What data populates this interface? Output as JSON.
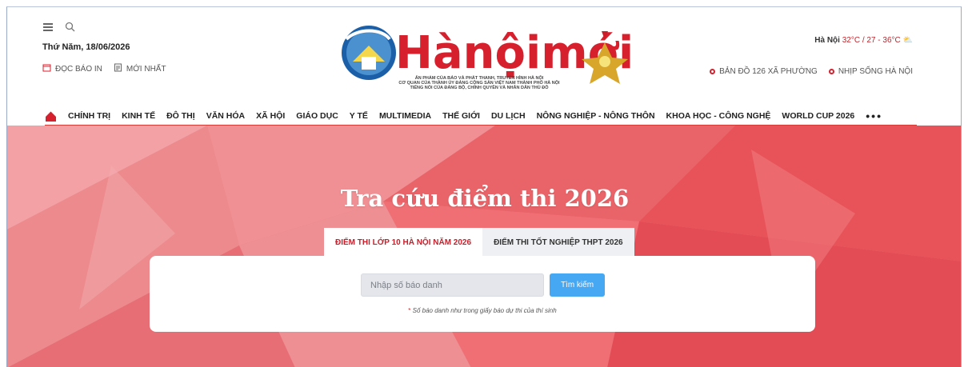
{
  "header": {
    "date": "Thứ Năm, 18/06/2026",
    "left_links": [
      "ĐỌC BÁO IN",
      "MỚI NHẤT"
    ],
    "logo_text": "Hànộimới",
    "tagline": [
      "ẤN PHẨM CỦA BÁO VÀ PHÁT THANH, TRUYỀN HÌNH HÀ NỘI",
      "CƠ QUAN CỦA THÀNH ỦY ĐẢNG CỘNG SẢN VIỆT NAM THÀNH PHỐ HÀ NỘI",
      "TIẾNG NÓI CỦA ĐẢNG BỘ, CHÍNH QUYỀN VÀ NHÂN DÂN THỦ ĐÔ"
    ],
    "weather": {
      "city": "Hà Nội",
      "temps": "32°C / 27 - 36°C"
    },
    "right_links": [
      "BẢN ĐỒ 126 XÃ PHƯỜNG",
      "NHỊP SỐNG HÀ NỘI"
    ]
  },
  "nav": [
    "CHÍNH TRỊ",
    "KINH TẾ",
    "ĐÔ THỊ",
    "VĂN HÓA",
    "XÃ HỘI",
    "GIÁO DỤC",
    "Y TẾ",
    "MULTIMEDIA",
    "THẾ GIỚI",
    "DU LỊCH",
    "NÔNG NGHIỆP - NÔNG THÔN",
    "KHOA HỌC - CÔNG NGHỆ",
    "WORLD CUP 2026",
    "•••"
  ],
  "hero": {
    "title": "Tra cứu điểm thi 2026",
    "tabs": [
      "ĐIỂM THI LỚP 10 HÀ NỘI NĂM 2026",
      "ĐIỂM THI TỐT NGHIỆP THPT 2026"
    ],
    "input_placeholder": "Nhập số báo danh",
    "search_button": "Tìm kiếm",
    "note": "Số báo danh như trong giấy báo dự thi của thí sinh"
  },
  "colors": {
    "brand_red": "#d7202e",
    "button_blue": "#46a7f2"
  }
}
